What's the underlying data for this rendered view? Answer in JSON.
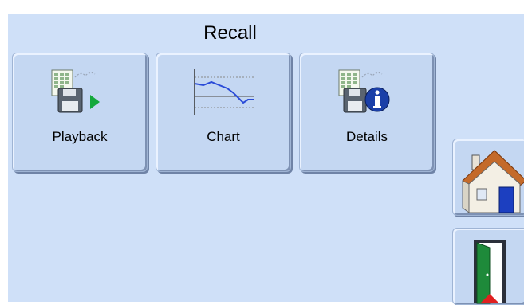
{
  "screen": {
    "title": "Recall"
  },
  "tiles": [
    {
      "label": "Playback",
      "icon": "playback-icon"
    },
    {
      "label": "Chart",
      "icon": "chart-icon"
    },
    {
      "label": "Details",
      "icon": "details-icon"
    }
  ],
  "side_buttons": {
    "home": {
      "icon": "home-icon"
    },
    "exit": {
      "icon": "exit-door-icon"
    }
  },
  "colors": {
    "background": "#cfe0f8",
    "button_face": "#c4d7f2",
    "play_green": "#14a83c",
    "info_blue": "#1a3fa8",
    "chart_line": "#2a4bd8"
  }
}
